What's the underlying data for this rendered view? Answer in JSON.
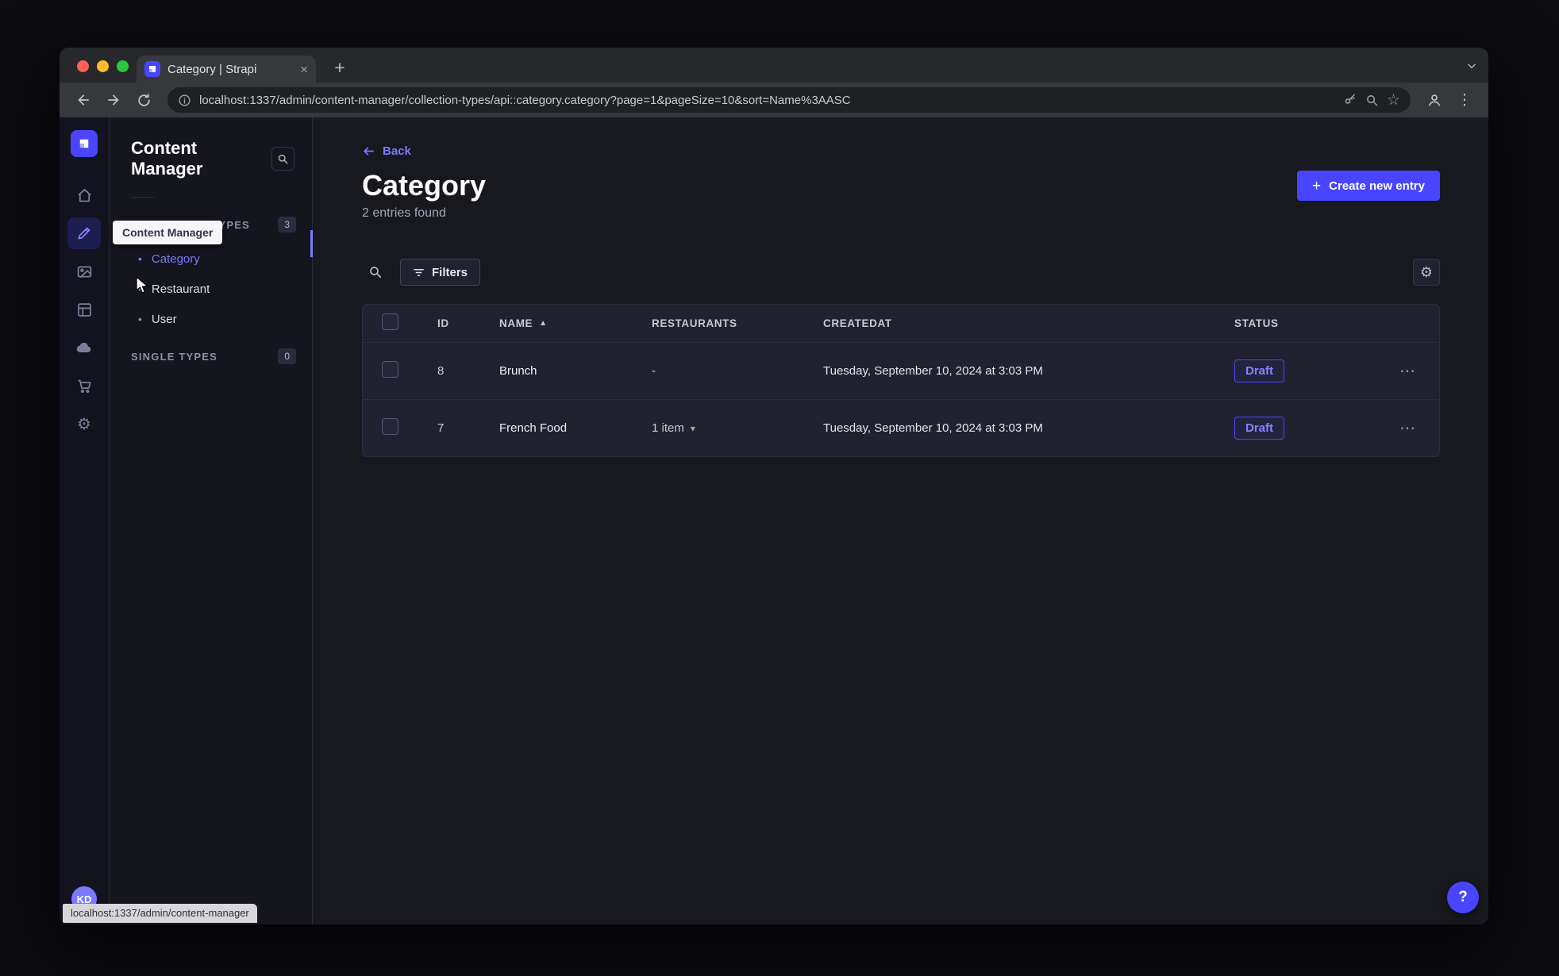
{
  "browser": {
    "tab_title": "Category | Strapi",
    "url": "localhost:1337/admin/content-manager/collection-types/api::category.category?page=1&pageSize=10&sort=Name%3AASC",
    "status_bubble": "localhost:1337/admin/content-manager"
  },
  "rail": {
    "tooltip": "Content Manager",
    "avatar_initials": "KD"
  },
  "subnav": {
    "title": "Content Manager",
    "collection_types": {
      "label": "COLLECTION TYPES",
      "badge": "3",
      "items": [
        {
          "label": "Category",
          "active": true
        },
        {
          "label": "Restaurant",
          "active": false
        },
        {
          "label": "User",
          "active": false
        }
      ]
    },
    "single_types": {
      "label": "SINGLE TYPES",
      "badge": "0"
    }
  },
  "main": {
    "back_label": "Back",
    "title": "Category",
    "subtitle": "2 entries found",
    "create_button": "Create new entry",
    "filters_label": "Filters",
    "table": {
      "headers": {
        "id": "ID",
        "name": "NAME",
        "restaurants": "RESTAURANTS",
        "createdat": "CREATEDAT",
        "status": "STATUS"
      },
      "rows": [
        {
          "id": "8",
          "name": "Brunch",
          "restaurants": "-",
          "createdat": "Tuesday, September 10, 2024 at 3:03 PM",
          "status": "Draft"
        },
        {
          "id": "7",
          "name": "French Food",
          "restaurants": "1 item",
          "createdat": "Tuesday, September 10, 2024 at 3:03 PM",
          "status": "Draft"
        }
      ]
    }
  },
  "icons": {
    "plus": "+",
    "new_tab": "+",
    "close": "×",
    "kebab": "⋮",
    "ellipsis": "⋯",
    "star": "☆",
    "sort_asc": "▲",
    "caret_down": "▾",
    "gear": "⚙",
    "help": "?",
    "bullet": "•"
  },
  "colors": {
    "primary": "#4945ff",
    "primary_light": "#7b79ff"
  }
}
